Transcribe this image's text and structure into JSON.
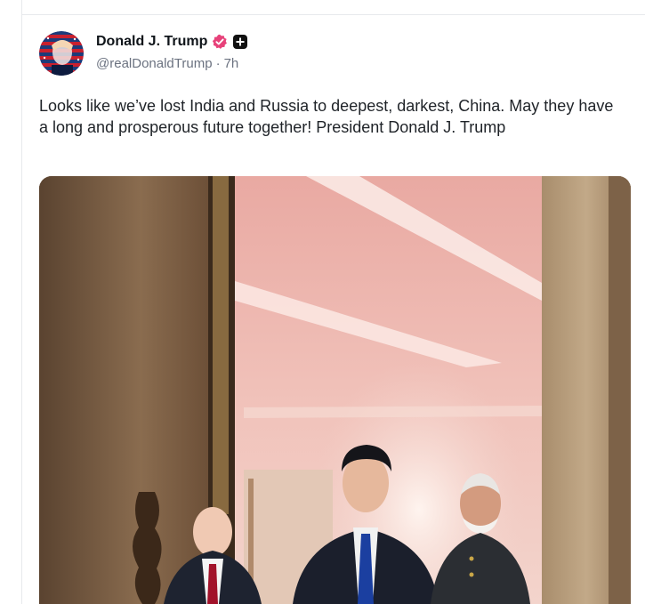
{
  "post": {
    "author": {
      "display_name": "Donald J. Trump",
      "handle": "@realDonaldTrump",
      "verified": true
    },
    "separator": "·",
    "timestamp": "7h",
    "text": "Looks like we’ve lost India and Russia to deepest, darkest, China. May they have a long and prosperous future together! President Donald J. Trump"
  },
  "colors": {
    "verified_badge": "#e7427a",
    "meta_text": "#6b7280",
    "divider": "#e7e9ec"
  },
  "icons": {
    "verified": "verified-badge-icon",
    "affiliation": "plus-square-icon"
  }
}
